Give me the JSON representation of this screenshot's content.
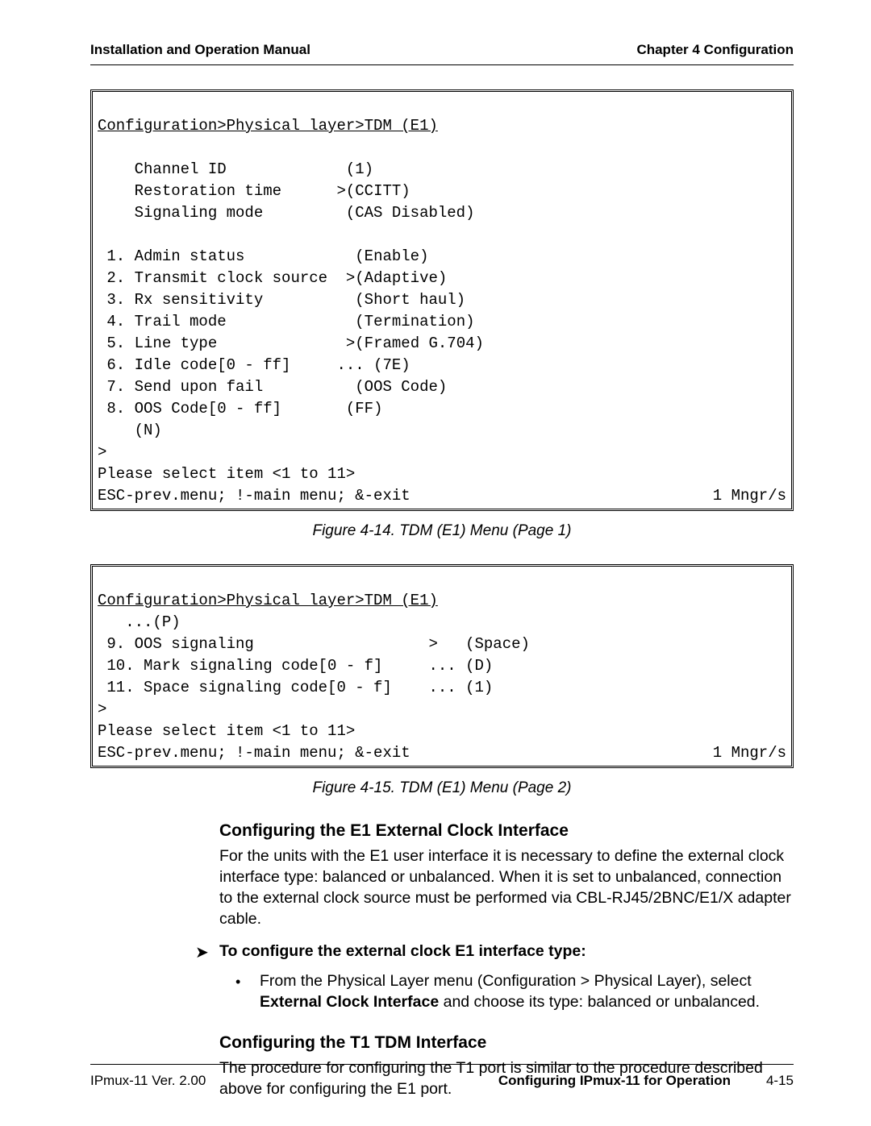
{
  "header": {
    "left": "Installation and Operation Manual",
    "right": "Chapter 4  Configuration"
  },
  "terminal1": {
    "breadcrumb": "Configuration>Physical layer>TDM (E1)",
    "ro1_label": "    Channel ID",
    "ro1_value": " (1)",
    "ro2_label": "    Restoration time",
    "ro2_value": ">(CCITT)",
    "ro3_label": "    Signaling mode",
    "ro3_value": " (CAS Disabled)",
    "i1_label": " 1. Admin status",
    "i1_value": " (Enable)",
    "i2_label": " 2. Transmit clock source",
    "i2_value": ">(Adaptive)",
    "i3_label": " 3. Rx sensitivity",
    "i3_value": " (Short haul)",
    "i4_label": " 4. Trail mode",
    "i4_value": " (Termination)",
    "i5_label": " 5. Line type",
    "i5_value": ">(Framed G.704)",
    "i6_label": " 6. Idle code[0 - ff]",
    "i6_value": "... (7E)",
    "i7_label": " 7. Send upon fail",
    "i7_value": " (OOS Code)",
    "i8_label": " 8. OOS Code[0 - ff]",
    "i8_value": " (FF)",
    "tail1": "    (N)",
    "tail2": ">",
    "select_line": "Please select item <1 to 11>",
    "footer_left": "ESC-prev.menu; !-main menu; &-exit",
    "footer_right": "1 Mngr/s"
  },
  "caption1": "Figure 4-14.  TDM (E1) Menu (Page 1)",
  "terminal2": {
    "breadcrumb": "Configuration>Physical layer>TDM (E1)",
    "cont": "   ...(P)",
    "i9_label": " 9. OOS signaling",
    "i9_value": ">   (Space)",
    "i10_label": " 10. Mark signaling code[0 - f]",
    "i10_value": "... (D)",
    "i11_label": " 11. Space signaling code[0 - f]",
    "i11_value": "... (1)",
    "tail": ">",
    "select_line": "Please select item <1 to 11>",
    "footer_left": "ESC-prev.menu; !-main menu; &-exit",
    "footer_right": "1 Mngr/s"
  },
  "caption2": "Figure 4-15.  TDM (E1) Menu (Page 2)",
  "sectionA": {
    "title": "Configuring the E1 External Clock Interface",
    "para": "For the units with the E1 user interface it is necessary to define the external clock interface type: balanced or unbalanced. When it is set to unbalanced, connection to the external clock source must be performed via CBL-RJ45/2BNC/E1/X adapter cable.",
    "proc_title": "To configure the external clock E1 interface type:",
    "step_pre": "From the Physical Layer menu (Configuration > Physical Layer), select ",
    "step_bold": "External Clock Interface",
    "step_post": " and choose its type: balanced or unbalanced."
  },
  "sectionB": {
    "title": "Configuring the T1 TDM Interface",
    "para": "The procedure for configuring the T1 port is similar to the procedure described above for configuring the E1 port."
  },
  "footer": {
    "left": "IPmux-11 Ver. 2.00",
    "section": "Configuring IPmux-11 for Operation",
    "page": "4-15"
  }
}
